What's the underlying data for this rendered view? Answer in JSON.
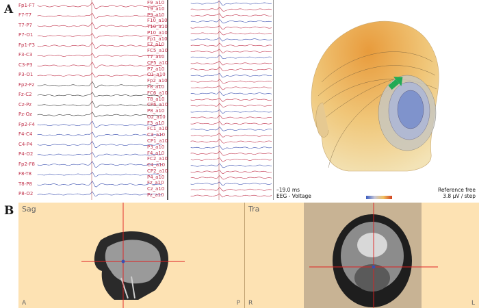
{
  "panels": {
    "a_label": "A",
    "b_label": "B"
  },
  "traces": {
    "left_column": [
      "Fp1-F7",
      "F7-T7",
      "T7-P7",
      "P7-O1",
      "Fp1-F3",
      "F3-C3",
      "C3-P3",
      "P3-O1",
      "Fp2-Fz",
      "Fz-C2",
      "Cz-Pz",
      "Pz-Oz",
      "Fp2-F4",
      "F4-C4",
      "C4-P4",
      "P4-O2",
      "Fp2-F8",
      "F8-T8",
      "T8-P8",
      "P8-O2"
    ],
    "right_column": [
      "F9_a10",
      "T9_a10",
      "P9_a10",
      "F10_a10",
      "T10_a10",
      "P10_a10",
      "Fp1_a10",
      "F7_a10",
      "FC5_a10",
      "T7_a10",
      "CP5_a10",
      "P7_a10",
      "O1_a10",
      "Fp2_a10",
      "F8_a10",
      "FC6_a10",
      "T8_a10",
      "CP6_a10",
      "P8_a10",
      "O2_a10",
      "F3_a10",
      "FC1_a10",
      "C3_a10",
      "CP1_a10",
      "P3_a10",
      "F4_a10",
      "FC2_a10",
      "C4_a10",
      "CP2_a10",
      "P4_a10",
      "Fz_a10",
      "Cz_a10",
      "Pz_a10"
    ],
    "colors": {
      "red": "#c0304a",
      "blue": "#3a4fb0",
      "black": "#333333"
    }
  },
  "topo": {
    "time": "–19.0 ms",
    "mode": "EEG - Voltage",
    "reference": "Reference free",
    "step": "3.8 µV / step",
    "arrow_color": "#22aa55"
  },
  "mri": {
    "sag": {
      "title": "Sag",
      "left": "A",
      "right": "P"
    },
    "tra": {
      "title": "Tra",
      "left": "R",
      "right": "L"
    },
    "crosshair_color": "#e02020"
  }
}
